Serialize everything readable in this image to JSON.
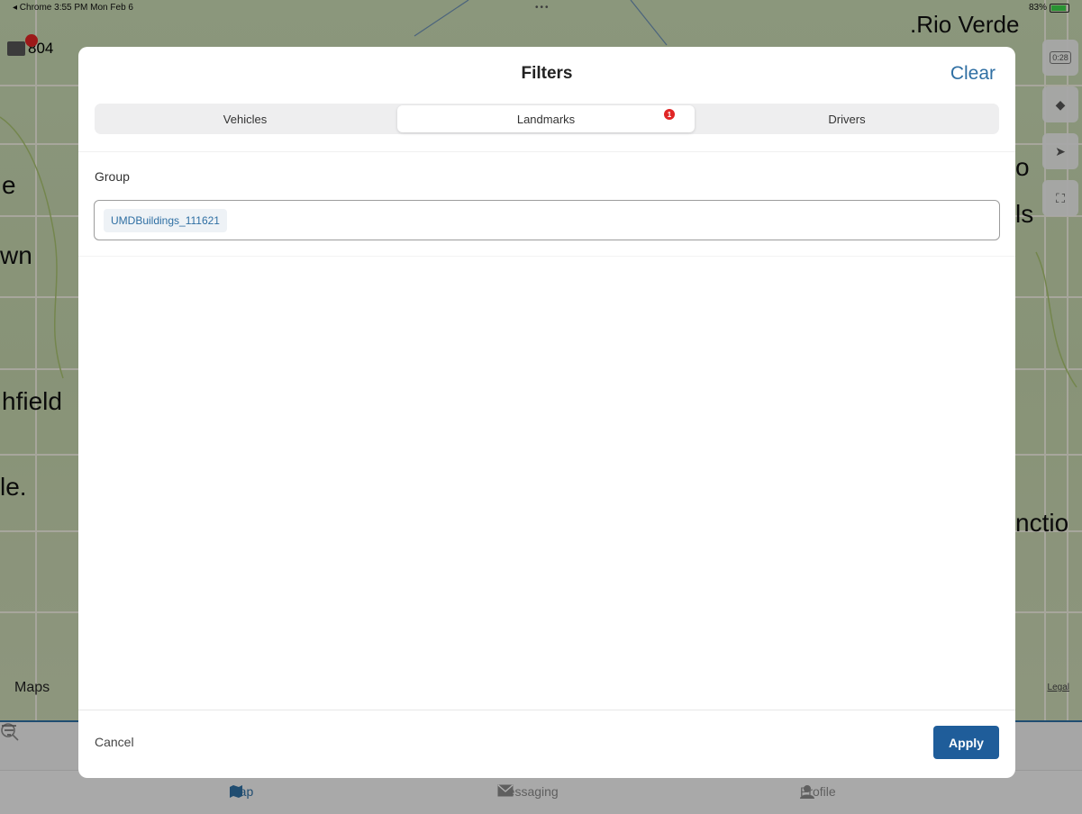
{
  "status_bar": {
    "left": "◂ Chrome   3:55 PM   Mon Feb 6",
    "dots": "•••",
    "battery": "83%"
  },
  "map": {
    "vehicle_label": "804",
    "labels": {
      "rio_verde": ".Rio Verde",
      "left_e": "e",
      "left_wn": "wn",
      "left_chfield": "hfield",
      "left_le": "le.",
      "right_o": "o",
      "right_ls": "ls",
      "right_nction": "nctio"
    },
    "maps_logo": "Maps",
    "legal": "Legal",
    "ctrl_time": "0:28"
  },
  "modal": {
    "title": "Filters",
    "clear": "Clear",
    "tabs": [
      {
        "label": "Vehicles"
      },
      {
        "label": "Landmarks",
        "badge": "1"
      },
      {
        "label": "Drivers"
      }
    ],
    "group_label": "Group",
    "group_chip": "UMDBuildings_111621",
    "cancel": "Cancel",
    "apply": "Apply"
  },
  "tabbar": {
    "map": "Map",
    "messaging": "Messaging",
    "profile": "Profile"
  },
  "colors": {
    "accent": "#2f6fa3",
    "apply_bg": "#1f5d9a",
    "badge": "#e02525"
  }
}
